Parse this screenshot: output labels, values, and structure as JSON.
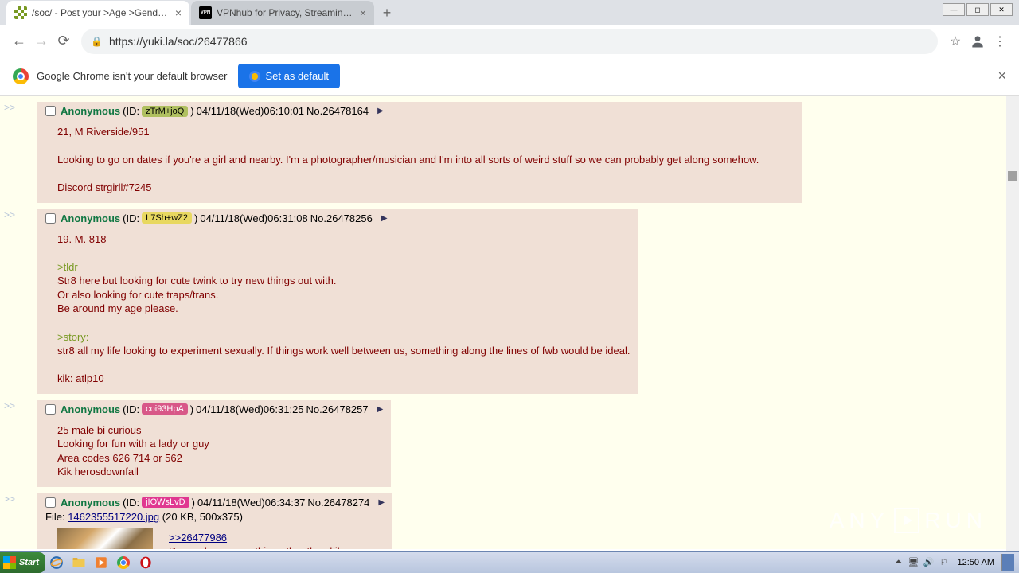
{
  "browser": {
    "tabs": [
      {
        "title": "/soc/ - Post your >Age >Gender >A",
        "favicon": "fourchan"
      },
      {
        "title": "VPNhub for Privacy, Streaming and M",
        "favicon": "vpn",
        "favicon_text": "VPN"
      }
    ],
    "url": "https://yuki.la/soc/26477866",
    "infobar_text": "Google Chrome isn't your default browser",
    "set_default_label": "Set as default"
  },
  "posts": [
    {
      "name": "Anonymous",
      "id": "zTrM+joQ",
      "id_bg": "#b0c060",
      "id_fg": "#000",
      "date": "04/11/18(Wed)06:10:01",
      "no": "No.26478164",
      "wide": true,
      "lines": [
        {
          "t": "21, M Riverside/951"
        },
        {
          "t": ""
        },
        {
          "t": "Looking to go on dates if you're a girl and nearby. I'm a photographer/musician and I'm into all sorts of weird stuff so we can probably get along somehow."
        },
        {
          "t": ""
        },
        {
          "t": "Discord strgirll#7245"
        }
      ]
    },
    {
      "name": "Anonymous",
      "id": "L7Sh+wZ2",
      "id_bg": "#e8d860",
      "id_fg": "#000",
      "date": "04/11/18(Wed)06:31:08",
      "no": "No.26478256",
      "lines": [
        {
          "t": "19. M. 818"
        },
        {
          "t": ""
        },
        {
          "t": ">tldr",
          "green": true
        },
        {
          "t": "Str8 here but looking for cute twink to try new things out with."
        },
        {
          "t": "Or also looking for cute traps/trans."
        },
        {
          "t": "Be around my age please."
        },
        {
          "t": ""
        },
        {
          "t": ">story:",
          "green": true
        },
        {
          "t": "str8 all my life looking to experiment sexually. If things work well between us, something along the lines of fwb would be ideal."
        },
        {
          "t": ""
        },
        {
          "t": "kik: atlp10"
        }
      ]
    },
    {
      "name": "Anonymous",
      "id": "coi93HpA",
      "id_bg": "#d85888",
      "id_fg": "#fff",
      "date": "04/11/18(Wed)06:31:25",
      "no": "No.26478257",
      "lines": [
        {
          "t": "25 male bi curious"
        },
        {
          "t": "Looking for fun with a lady or guy"
        },
        {
          "t": "Area codes 626 714 or 562"
        },
        {
          "t": "Kik herosdownfall"
        }
      ]
    },
    {
      "name": "Anonymous",
      "id": "jIOWsLvD",
      "id_bg": "#e03890",
      "id_fg": "#fff",
      "date": "04/11/18(Wed)06:34:37",
      "no": "No.26478274",
      "file": {
        "name": "1462355517220.jpg",
        "meta": "(20 KB, 500x375)"
      },
      "reply_link": ">>26477986",
      "lines": [
        {
          "t": "Do you have something other than kik"
        }
      ]
    }
  ],
  "watermark": {
    "left": "ANY",
    "right": "RUN"
  },
  "taskbar": {
    "start": "Start",
    "clock": "12:50 AM"
  },
  "file_label": "File: "
}
